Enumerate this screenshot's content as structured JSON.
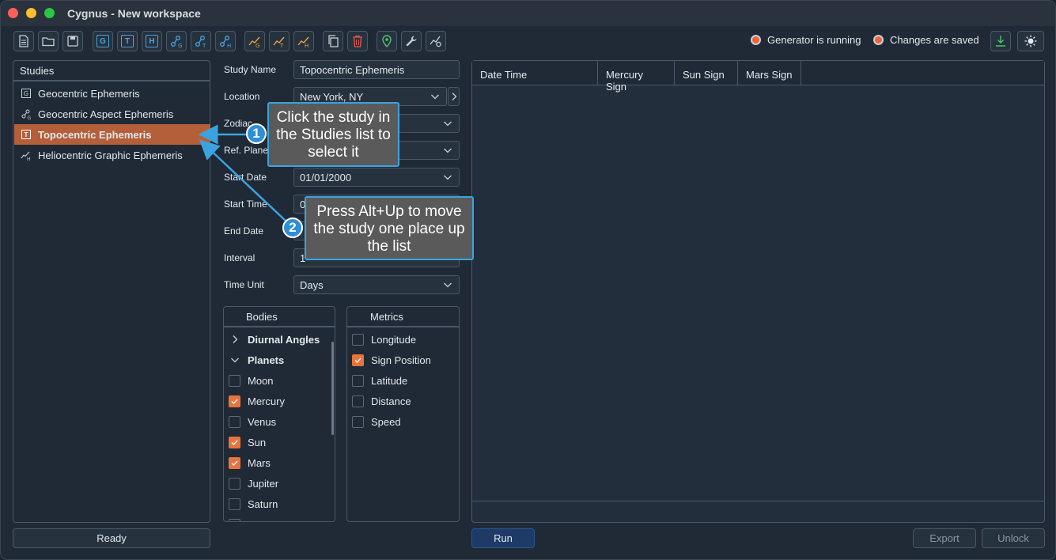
{
  "window": {
    "title": "Cygnus - New workspace"
  },
  "toolbar": {
    "buttons": [
      {
        "name": "new-file-icon"
      },
      {
        "name": "open-folder-icon"
      },
      {
        "name": "save-icon"
      },
      {
        "name": "geocentric-study-icon",
        "letter": "G"
      },
      {
        "name": "topocentric-study-icon",
        "letter": "T"
      },
      {
        "name": "heliocentric-study-icon",
        "letter": "H"
      },
      {
        "name": "aspect-g-icon",
        "letter": "G"
      },
      {
        "name": "aspect-t-icon",
        "letter": "T"
      },
      {
        "name": "aspect-h-icon",
        "letter": "H"
      },
      {
        "name": "graphic-g-icon",
        "letter": "G"
      },
      {
        "name": "graphic-t-icon",
        "letter": "T"
      },
      {
        "name": "graphic-h-icon",
        "letter": "H"
      },
      {
        "name": "copy-icon"
      },
      {
        "name": "trash-icon"
      },
      {
        "name": "location-pin-icon"
      },
      {
        "name": "wrench-icon"
      },
      {
        "name": "settings-graph-icon"
      }
    ],
    "status_generator": "Generator is running",
    "status_saved": "Changes are saved"
  },
  "studies": {
    "header": "Studies",
    "items": [
      {
        "label": "Geocentric Ephemeris",
        "icon": "G"
      },
      {
        "label": "Geocentric Aspect Ephemeris",
        "icon": "aspect"
      },
      {
        "label": "Topocentric Ephemeris",
        "icon": "T",
        "selected": true
      },
      {
        "label": "Heliocentric Graphic Ephemeris",
        "icon": "graphic"
      }
    ],
    "status": "Ready"
  },
  "form": {
    "study_name_label": "Study Name",
    "study_name_value": "Topocentric Ephemeris",
    "location_label": "Location",
    "location_value": "New York, NY",
    "zodiac_label": "Zodiac",
    "ref_plane_label": "Ref. Plane",
    "start_date_label": "Start Date",
    "start_date_value": "01/01/2000",
    "start_time_label": "Start Time",
    "start_time_value": "0",
    "end_date_label": "End Date",
    "interval_label": "Interval",
    "interval_value": "1",
    "time_unit_label": "Time Unit",
    "time_unit_value": "Days"
  },
  "bodies": {
    "header": "Bodies",
    "rows": [
      {
        "label": "Diurnal Angles",
        "type": "group",
        "expanded": false
      },
      {
        "label": "Planets",
        "type": "group",
        "expanded": true
      },
      {
        "label": "Moon",
        "checked": false
      },
      {
        "label": "Mercury",
        "checked": true
      },
      {
        "label": "Venus",
        "checked": false
      },
      {
        "label": "Sun",
        "checked": true
      },
      {
        "label": "Mars",
        "checked": true
      },
      {
        "label": "Jupiter",
        "checked": false
      },
      {
        "label": "Saturn",
        "checked": false
      }
    ]
  },
  "metrics": {
    "header": "Metrics",
    "rows": [
      {
        "label": "Longitude",
        "checked": false
      },
      {
        "label": "Sign Position",
        "checked": true
      },
      {
        "label": "Latitude",
        "checked": false
      },
      {
        "label": "Distance",
        "checked": false
      },
      {
        "label": "Speed",
        "checked": false
      }
    ]
  },
  "results": {
    "columns": [
      "Date Time",
      "Mercury Sign",
      "Sun Sign",
      "Mars Sign"
    ]
  },
  "actions": {
    "run": "Run",
    "export": "Export",
    "unlock": "Unlock"
  },
  "callouts": {
    "one_number": "1",
    "one_text": "Click the study in the Studies list to select it",
    "two_number": "2",
    "two_text": "Press Alt+Up to move the study one place up the list"
  },
  "colors": {
    "accent": "#e8743c",
    "selected": "#b45f3a",
    "callout_border": "#3ba3df"
  }
}
